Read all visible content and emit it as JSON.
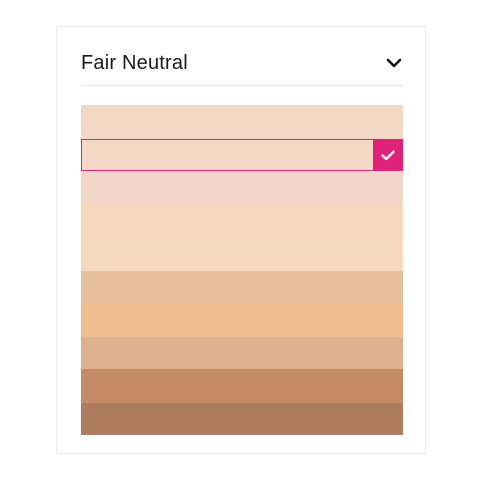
{
  "dropdown": {
    "selected_label": "Fair Neutral",
    "chevron_icon": "chevron-down-icon"
  },
  "swatches": {
    "selected_index": 1,
    "check_icon": "checkmark-icon",
    "accent_color": "#e0217a",
    "items": [
      {
        "color": "#f3d9c5"
      },
      {
        "color": "#f4d8c6"
      },
      {
        "color": "#f2d6c8"
      },
      {
        "color": "#f7d8bd"
      },
      {
        "color": "#f6d9bc"
      },
      {
        "color": "#e7c0a0"
      },
      {
        "color": "#f0bd8d"
      },
      {
        "color": "#ddb08f"
      },
      {
        "color": "#c58b66"
      },
      {
        "color": "#ae7d60"
      }
    ]
  }
}
